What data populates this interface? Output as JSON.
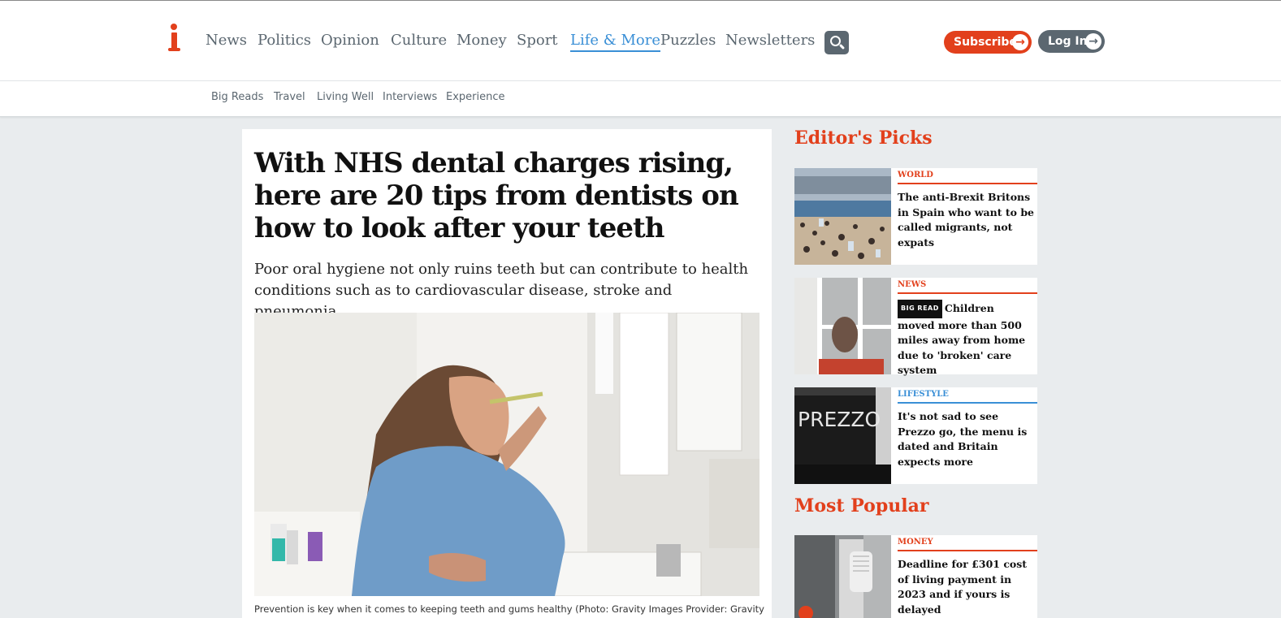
{
  "header": {
    "logo_text": "i",
    "nav": [
      {
        "label": "News",
        "active": false
      },
      {
        "label": "Politics",
        "active": false
      },
      {
        "label": "Opinion",
        "active": false
      },
      {
        "label": "Culture",
        "active": false
      },
      {
        "label": "Money",
        "active": false
      },
      {
        "label": "Sport",
        "active": false
      },
      {
        "label": "Life & More",
        "active": true
      },
      {
        "label": "Puzzles",
        "active": false
      },
      {
        "label": "Newsletters",
        "active": false
      }
    ],
    "search_icon": "search-icon",
    "subscribe_label": "Subscribe",
    "login_label": "Log In"
  },
  "subnav": [
    "Big Reads",
    "Travel",
    "Living Well",
    "Interviews",
    "Experience"
  ],
  "article": {
    "headline": "With NHS dental charges rising, here are 20 tips from dentists on how to look after your teeth",
    "standfirst": "Poor oral hygiene not only ruins teeth but can contribute to health conditions such as to cardiovascular disease, stroke and pneumonia.",
    "caption": "Prevention is key when it comes to keeping teeth and gums healthy (Photo: Gravity Images Provider: Gravity"
  },
  "sidebar": {
    "editors_picks_title": "Editor's Picks",
    "editors_picks": [
      {
        "category": "WORLD",
        "title": "The anti-Brexit Britons in Spain who want to be called migrants, not expats",
        "badge": ""
      },
      {
        "category": "NEWS",
        "title": "Children moved more than 500 miles away from home due to 'broken' care system",
        "badge": "BIG READ"
      },
      {
        "category": "LIFESTYLE",
        "title": "It's not sad to see Prezzo go, the menu is dated and Britain expects more",
        "badge": "",
        "thumb_text": "PREZZO"
      }
    ],
    "most_popular_title": "Most Popular",
    "most_popular": [
      {
        "category": "MONEY",
        "title": "Deadline for £301 cost of living payment in 2023 and if yours is delayed"
      }
    ]
  },
  "colors": {
    "brand_red": "#e2401c",
    "nav_grey": "#5b6770",
    "accent_blue": "#3a8fd6",
    "page_bg": "#e9ecee"
  }
}
